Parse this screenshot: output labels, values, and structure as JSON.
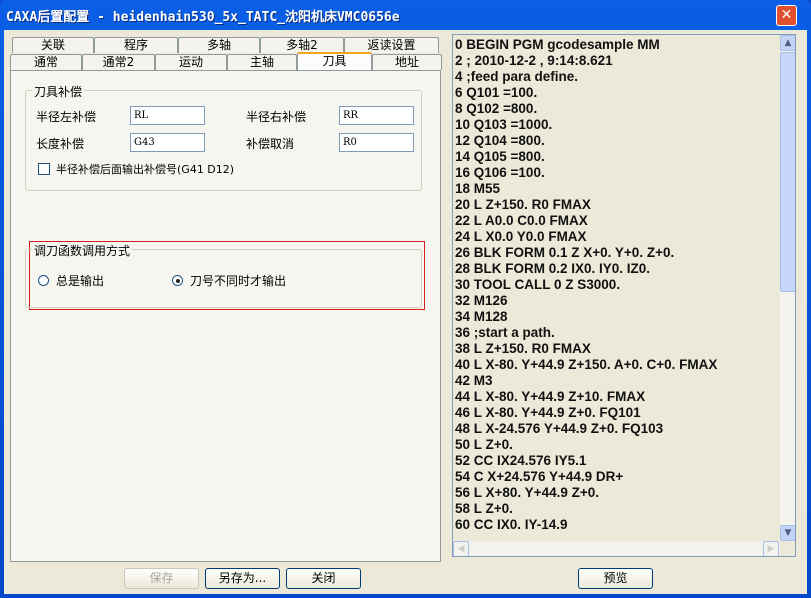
{
  "window": {
    "title": "CAXA后置配置 - heidenhain530_5x_TATC_沈阳机床VMC0656e",
    "close": "✕"
  },
  "tabs_top": [
    "关联",
    "程序",
    "多轴",
    "多轴2",
    "返读设置"
  ],
  "tabs_bottom": [
    "通常",
    "通常2",
    "运动",
    "主轴",
    "刀具",
    "地址"
  ],
  "active_tab": "刀具",
  "tool_comp": {
    "title": "刀具补偿",
    "left_label": "半径左补偿",
    "left_value": "RL",
    "right_label": "半径右补偿",
    "right_value": "RR",
    "length_label": "长度补偿",
    "length_value": "G43",
    "cancel_label": "补偿取消",
    "cancel_value": "R0",
    "checkbox_label": "半径补偿后面输出补偿号(G41 D12)",
    "checkbox_checked": false
  },
  "tool_call": {
    "title": "调刀函数调用方式",
    "option1": "总是输出",
    "option2": "刀号不同时才输出",
    "selected": "option2"
  },
  "code_lines": [
    "0 BEGIN PGM gcodesample MM",
    "2 ; 2010-12-2 , 9:14:8.621",
    "4 ;feed para define.",
    "6 Q101 =100.",
    "8 Q102 =800.",
    "10 Q103 =1000.",
    "12 Q104 =800.",
    "14 Q105 =800.",
    "16 Q106 =100.",
    "18 M55",
    "20 L Z+150. R0 FMAX",
    "22 L A0.0 C0.0 FMAX",
    "24 L X0.0 Y0.0 FMAX",
    "26 BLK FORM 0.1 Z X+0. Y+0. Z+0.",
    "28 BLK FORM 0.2 IX0. IY0. IZ0.",
    "30 TOOL CALL 0 Z S3000.",
    "32 M126",
    "34 M128",
    "36 ;start a path.",
    "38 L Z+150. R0 FMAX",
    "40 L X-80. Y+44.9 Z+150. A+0. C+0. FMAX",
    "42 M3",
    "44 L X-80. Y+44.9 Z+10. FMAX",
    "46 L X-80. Y+44.9 Z+0. FQ101",
    "48 L X-24.576 Y+44.9 Z+0. FQ103",
    "50 L Z+0.",
    "52 CC IX24.576 IY5.1",
    "54 C X+24.576 Y+44.9 DR+",
    "56 L X+80. Y+44.9 Z+0.",
    "58 L Z+0.",
    "60 CC IX0. IY-14.9"
  ],
  "buttons": {
    "save": "保存",
    "save_as": "另存为...",
    "close": "关闭",
    "preview": "预览"
  }
}
